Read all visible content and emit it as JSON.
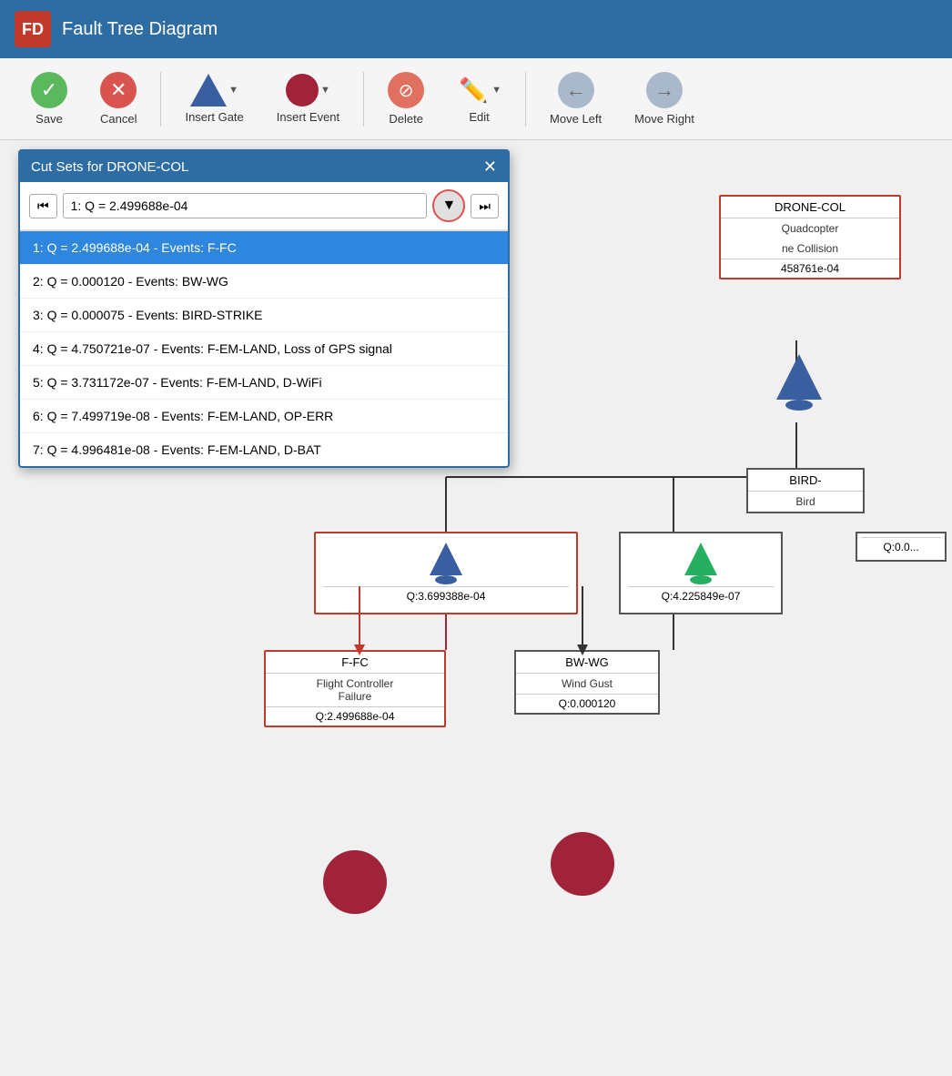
{
  "app": {
    "logo": "FD",
    "title": "Fault Tree Diagram"
  },
  "toolbar": {
    "save_label": "Save",
    "cancel_label": "Cancel",
    "insert_gate_label": "Insert Gate",
    "insert_event_label": "Insert Event",
    "delete_label": "Delete",
    "edit_label": "Edit",
    "move_left_label": "Move Left",
    "move_right_label": "Move Right"
  },
  "dialog": {
    "title": "Cut Sets for DRONE-COL",
    "current_value": "1: Q = 2.499688e-04",
    "items": [
      {
        "id": 1,
        "text": "1: Q = 2.499688e-04 - Events: F-FC",
        "selected": true
      },
      {
        "id": 2,
        "text": "2: Q = 0.000120 - Events: BW-WG",
        "selected": false
      },
      {
        "id": 3,
        "text": "3: Q = 0.000075 - Events: BIRD-STRIKE",
        "selected": false
      },
      {
        "id": 4,
        "text": "4: Q = 4.750721e-07 - Events: F-EM-LAND, Loss of GPS signal",
        "selected": false
      },
      {
        "id": 5,
        "text": "5: Q = 3.731172e-07 - Events: F-EM-LAND, D-WiFi",
        "selected": false
      },
      {
        "id": 6,
        "text": "6: Q = 7.499719e-08 - Events: F-EM-LAND, OP-ERR",
        "selected": false
      },
      {
        "id": 7,
        "text": "7: Q = 4.996481e-08 - Events: F-EM-LAND, D-BAT",
        "selected": false
      }
    ]
  },
  "diagram": {
    "drone_col": {
      "title": "DRONE-COL",
      "desc1": "Quadcopter",
      "desc2": "ne Collision",
      "q": "458761e-04"
    },
    "node_ffc": {
      "title": "F-FC",
      "desc": "Flight Controller\nFailure",
      "q": "Q:2.499688e-04"
    },
    "node_bwwg": {
      "title": "BW-WG",
      "desc": "Wind Gust",
      "q": "Q:0.000120"
    },
    "node_bird": {
      "title": "BIRD-",
      "desc": "Bird"
    },
    "gate1_q": "Q:3.699388e-04",
    "gate2_q": "Q:4.225849e-07",
    "gate3_q": "Q:0.0..."
  }
}
